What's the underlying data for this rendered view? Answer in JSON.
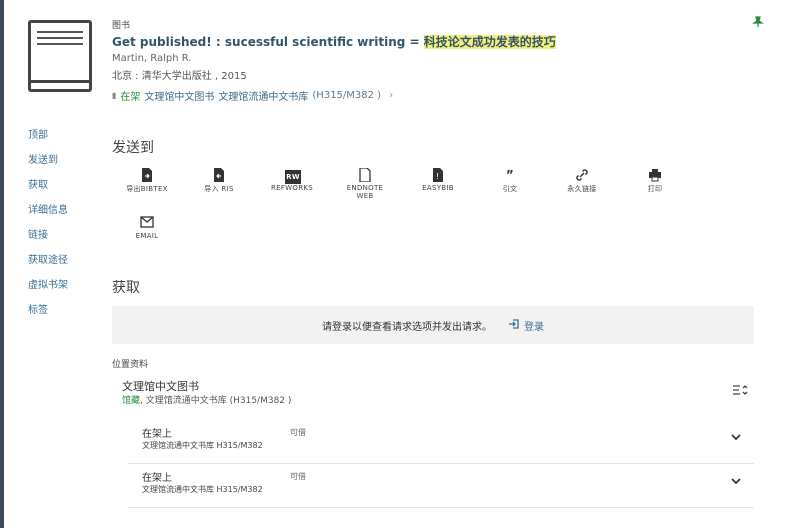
{
  "record": {
    "type": "图书",
    "title_en": "Get published! : sucessful scientific writing = ",
    "title_cn": "科技论文成功发表的技巧",
    "author": "Martin, Ralph R.",
    "publisher": "北京 : 清华大学出版社 , 2015",
    "avail_status": "在架",
    "avail_library": "文理馆中文图书",
    "avail_location": "文理馆流通中文书库",
    "avail_callno": "(H315/M382 )"
  },
  "sidenav": [
    "顶部",
    "发送到",
    "获取",
    "详细信息",
    "链接",
    "获取途径",
    "虚拟书架",
    "标签"
  ],
  "sendto": {
    "title": "发送到",
    "items": [
      {
        "label": "导出BIBTEX",
        "icon": "file-export-icon"
      },
      {
        "label": "导入 RIS",
        "icon": "file-import-icon"
      },
      {
        "label": "REFWORKS",
        "icon": "refworks-icon"
      },
      {
        "label": "ENDNOTE WEB",
        "icon": "endnote-icon"
      },
      {
        "label": "EASYBIB",
        "icon": "easybib-icon"
      },
      {
        "label": "引文",
        "icon": "quote-icon"
      },
      {
        "label": "永久链接",
        "icon": "link-icon"
      },
      {
        "label": "打印",
        "icon": "print-icon"
      },
      {
        "label": "EMAIL",
        "icon": "email-icon"
      }
    ]
  },
  "getit": {
    "title": "获取",
    "login_msg": "请登录以便查看请求选项并发出请求。",
    "login_link": "登录",
    "loc_label": "位置资料",
    "location": {
      "name": "文理馆中文图书",
      "status": "馆藏",
      "detail": ", 文理馆流通中文书库 (H315/M382 )"
    },
    "items": [
      {
        "status": "在架上",
        "location": "文理馆流通中文书库 H315/M382",
        "policy": "可借"
      },
      {
        "status": "在架上",
        "location": "文理馆流通中文书库 H315/M382",
        "policy": "可借"
      }
    ]
  }
}
